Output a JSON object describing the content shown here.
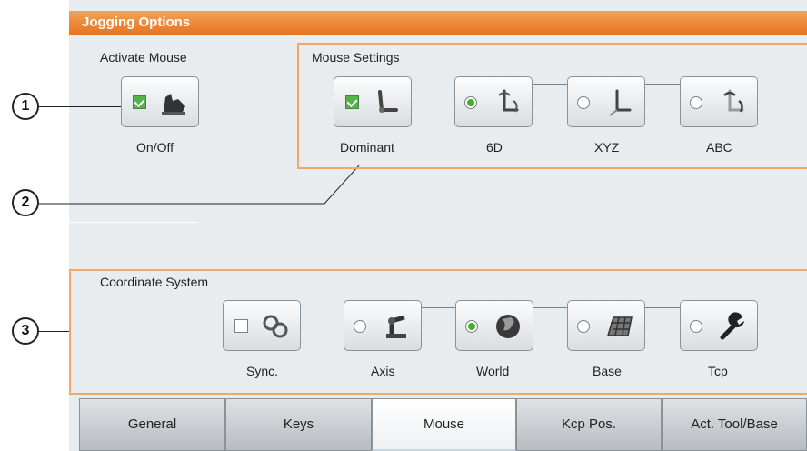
{
  "title": "Jogging Options",
  "callouts": [
    "1",
    "2",
    "3"
  ],
  "activate_mouse": {
    "label": "Activate Mouse",
    "button": {
      "caption": "On/Off",
      "checked": true,
      "icon": "mouse-hand-icon"
    }
  },
  "mouse_settings": {
    "label": "Mouse Settings",
    "dominant": {
      "caption": "Dominant",
      "checked": true,
      "icon": "robot-arm-icon"
    },
    "modes": [
      {
        "caption": "6D",
        "selected": true,
        "icon": "rotation-6d-icon"
      },
      {
        "caption": "XYZ",
        "selected": false,
        "icon": "translation-xyz-icon"
      },
      {
        "caption": "ABC",
        "selected": false,
        "icon": "rotation-abc-icon"
      }
    ]
  },
  "coordinate_system": {
    "label": "Coordinate System",
    "sync": {
      "caption": "Sync.",
      "checked": false,
      "icon": "link-chain-icon"
    },
    "options": [
      {
        "caption": "Axis",
        "selected": false,
        "icon": "robot-axis-icon"
      },
      {
        "caption": "World",
        "selected": true,
        "icon": "globe-icon"
      },
      {
        "caption": "Base",
        "selected": false,
        "icon": "grid-base-icon"
      },
      {
        "caption": "Tcp",
        "selected": false,
        "icon": "wrench-icon"
      }
    ]
  },
  "tabs": [
    {
      "label": "General",
      "active": false
    },
    {
      "label": "Keys",
      "active": false
    },
    {
      "label": "Mouse",
      "active": true
    },
    {
      "label": "Kcp Pos.",
      "active": false
    },
    {
      "label": "Act. Tool/Base",
      "active": false
    }
  ],
  "colors": {
    "title_bar": "#e8731f",
    "highlight_border": "#f0a86a",
    "selected_green": "#43b02a"
  }
}
